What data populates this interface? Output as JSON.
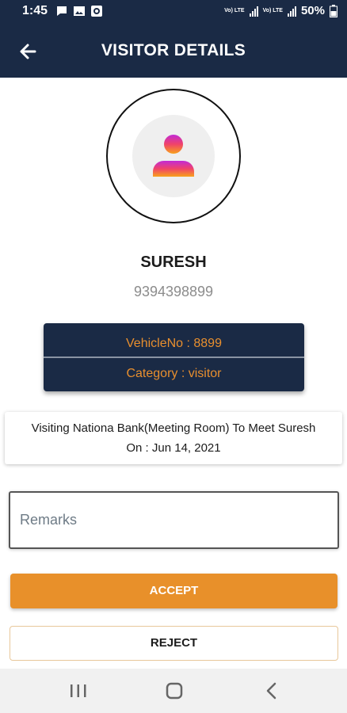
{
  "status_bar": {
    "time": "1:45",
    "battery": "50%",
    "network_label": "Vo) LTE"
  },
  "app_bar": {
    "title": "VISITOR DETAILS",
    "back_icon": "arrow-left-icon"
  },
  "visitor": {
    "name": "SURESH",
    "phone": "9394398899",
    "avatar_icon": "user-icon"
  },
  "info_card": {
    "vehicle": "VehicleNo : 8899",
    "category": "Category : visitor"
  },
  "visit": {
    "line1": "Visiting Nationa Bank(Meeting Room) To Meet Suresh",
    "line2": "On : Jun 14, 2021"
  },
  "remarks": {
    "placeholder": "Remarks",
    "value": ""
  },
  "actions": {
    "accept_label": "ACCEPT",
    "reject_label": "REJECT"
  },
  "colors": {
    "primary_dark": "#1a2a45",
    "accent_orange": "#e8902a",
    "text_orange": "#e88f2e"
  },
  "nav_bar": {
    "recents_icon": "recents-icon",
    "home_icon": "home-icon",
    "back_icon": "nav-back-icon"
  }
}
